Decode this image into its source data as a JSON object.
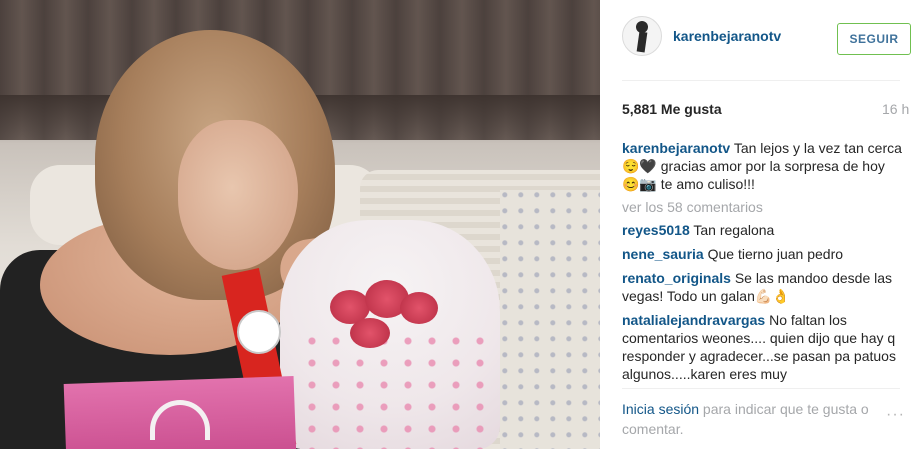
{
  "post": {
    "author": "karenbejaranotv",
    "follow_label": "SEGUIR",
    "likes": "5,881 Me gusta",
    "time_ago": "16 h",
    "caption": "Tan lejos y la vez tan cerca 😌🖤 gracias amor por la sorpresa de hoy 😊📷 te amo culiso!!!",
    "view_comments": "ver los 58 comentarios",
    "comments": [
      {
        "user": "reyes5018",
        "text": "Tan regalona"
      },
      {
        "user": "nene_sauria",
        "text": "Que tierno juan pedro"
      },
      {
        "user": "renato_originals",
        "text": "Se las mandoo desde las vegas! Todo un galan💪🏻👌"
      },
      {
        "user": "natalialejandravargas",
        "text": "No faltan los comentarios weones.... quien dijo que hay q responder y agradecer...se pasan pa patuos algunos.....karen eres muy"
      }
    ]
  },
  "footer": {
    "login_link": "Inicia sesión",
    "login_text": " para indicar que te gusta o comentar.",
    "more_options": "···"
  },
  "icons": {
    "avatar": "profile-avatar",
    "more": "more-options-icon"
  },
  "colors": {
    "username": "#125688",
    "follow_border": "#70c050",
    "follow_text": "#3f729b",
    "muted": "#a5a7aa"
  }
}
